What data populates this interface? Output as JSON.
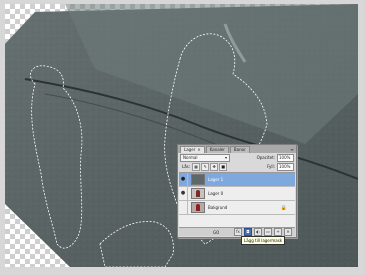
{
  "colors": {
    "rock": "#5f6a6a",
    "rock_dark": "#4a5455",
    "selection_layer": "#7fa9de",
    "tooltip_bg": "#ffffe1"
  },
  "panel": {
    "tabs": [
      {
        "label": "Lager",
        "active": true
      },
      {
        "label": "Kanaler",
        "active": false
      },
      {
        "label": "Banor",
        "active": false
      }
    ],
    "blend_mode": "Normal",
    "opacity_label": "Opacitet:",
    "opacity_value": "100%",
    "lock_label": "Lås:",
    "fill_label": "Fyll:",
    "fill_value": "100%",
    "layers": [
      {
        "name": "Lager 1",
        "thumb": "rock",
        "active": true,
        "locked": false
      },
      {
        "name": "Lager 0",
        "thumb": "person",
        "active": false,
        "locked": false
      },
      {
        "name": "Bakgrund",
        "thumb": "bg",
        "active": false,
        "locked": true
      }
    ],
    "bottom_icons": [
      "link-icon",
      "fx-icon",
      "mask-icon",
      "adjustment-icon",
      "folder-icon",
      "new-layer-icon",
      "trash-icon"
    ],
    "bottom_prefix": "GO"
  },
  "tooltip": "Lägg till lagermask"
}
